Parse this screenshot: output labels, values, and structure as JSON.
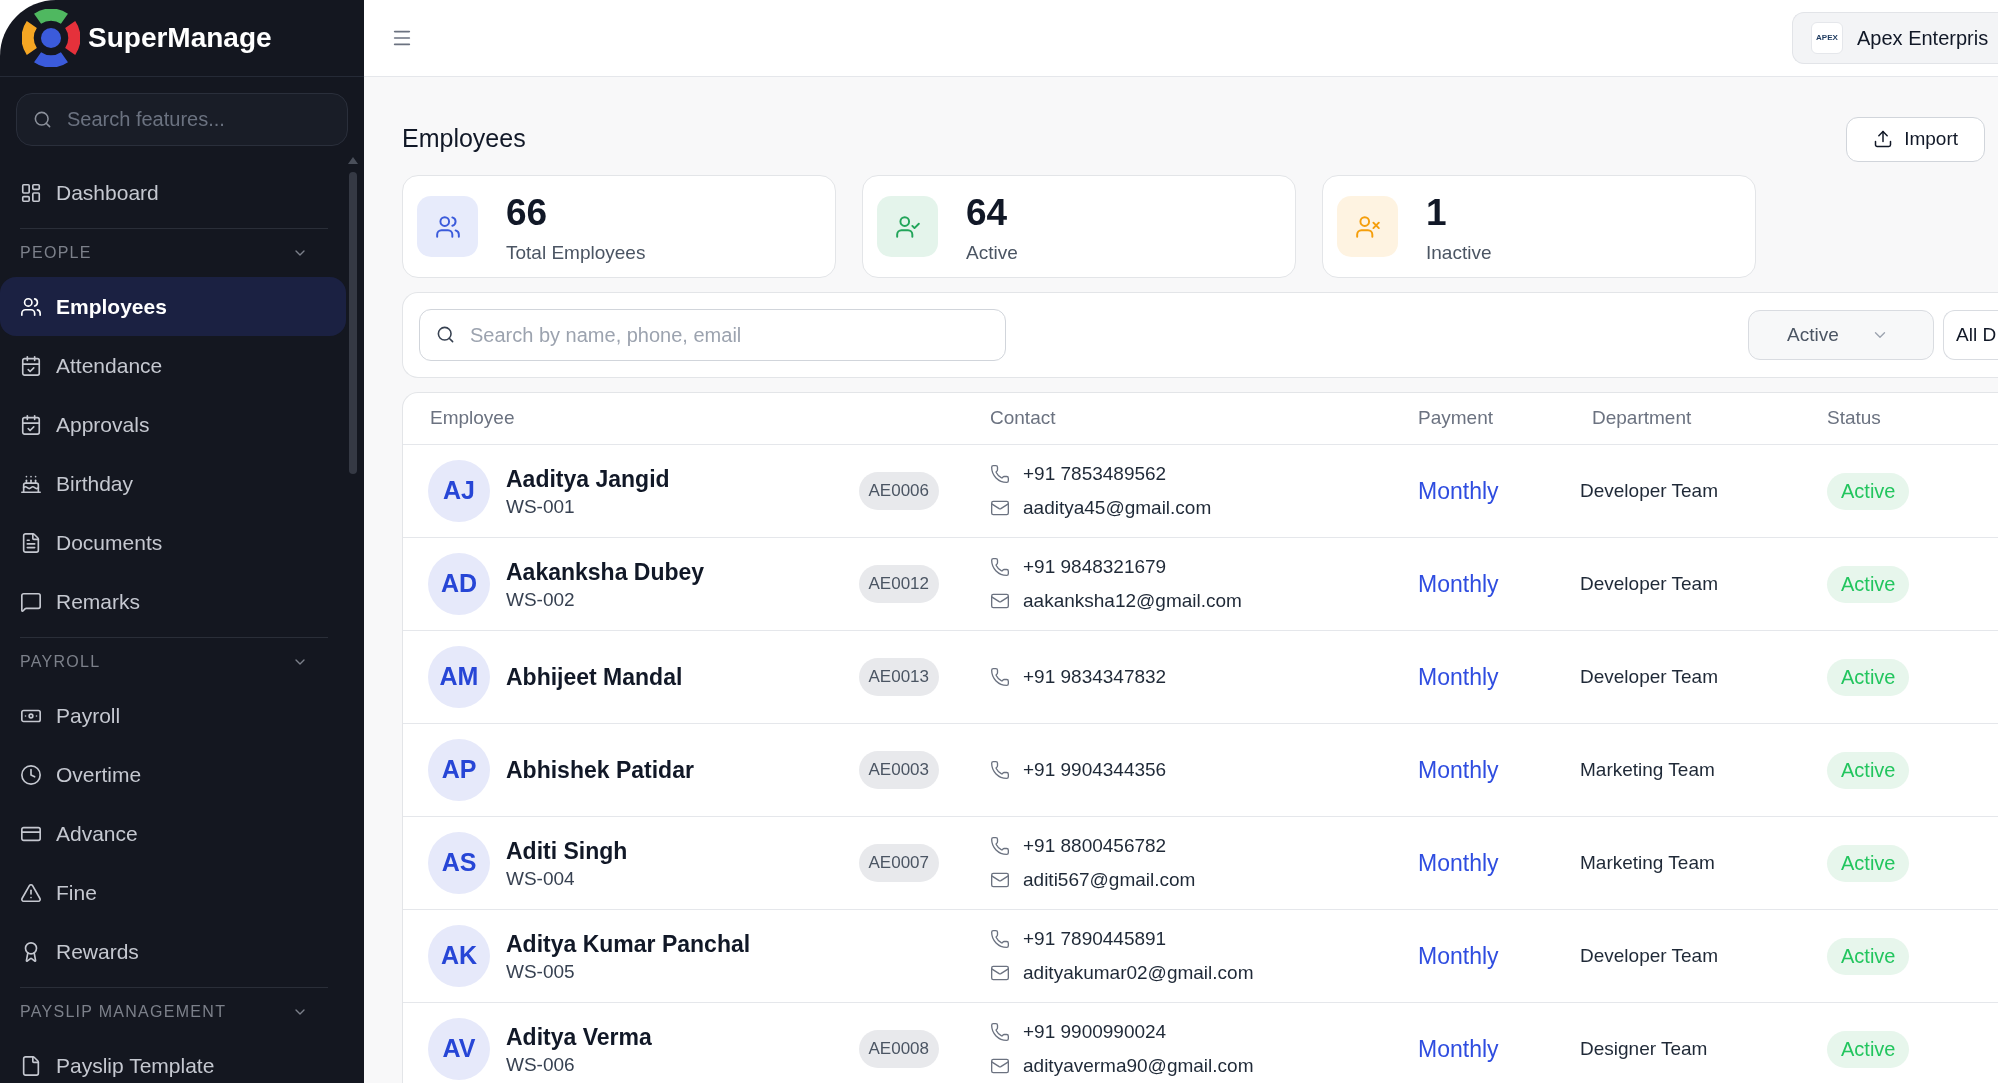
{
  "sidebar": {
    "brand": "SuperManage",
    "search": {
      "placeholder": "Search features..."
    },
    "top_items": [
      {
        "label": "Dashboard",
        "selected": false
      }
    ],
    "sections": [
      {
        "title": "PEOPLE",
        "expanded": true,
        "items": [
          {
            "label": "Employees",
            "selected": true
          },
          {
            "label": "Attendance",
            "selected": false
          },
          {
            "label": "Approvals",
            "selected": false
          },
          {
            "label": "Birthday",
            "selected": false
          },
          {
            "label": "Documents",
            "selected": false
          },
          {
            "label": "Remarks",
            "selected": false
          }
        ]
      },
      {
        "title": "PAYROLL",
        "expanded": true,
        "items": [
          {
            "label": "Payroll",
            "selected": false
          },
          {
            "label": "Overtime",
            "selected": false
          },
          {
            "label": "Advance",
            "selected": false
          },
          {
            "label": "Fine",
            "selected": false
          },
          {
            "label": "Rewards",
            "selected": false
          }
        ]
      },
      {
        "title": "PAYSLIP MANAGEMENT",
        "expanded": true,
        "items": [
          {
            "label": "Payslip Template",
            "selected": false
          }
        ]
      }
    ]
  },
  "top_bar": {
    "company": {
      "logo_text": "APEX",
      "name": "Apex Enterpris"
    }
  },
  "page": {
    "title": "Employees",
    "import_button": {
      "label": "Import"
    }
  },
  "stats": [
    {
      "value": "66",
      "label": "Total Employees",
      "color": "#3b5bdb"
    },
    {
      "value": "64",
      "label": "Active",
      "color": "#22a55a"
    },
    {
      "value": "1",
      "label": "Inactive",
      "color": "#f59e0b"
    }
  ],
  "filters": {
    "search": {
      "placeholder": "Search by name, phone, email"
    },
    "status": {
      "value": "Active"
    },
    "department": {
      "value": "All D"
    }
  },
  "table": {
    "columns": [
      "Employee",
      "Contact",
      "Payment",
      "Department",
      "Status"
    ],
    "rows": [
      {
        "initials": "AJ",
        "name": "Aaditya Jangid",
        "ws_id": "WS-001",
        "code": "AE0006",
        "phone": "+91 7853489562",
        "email": "aaditya45@gmail.com",
        "payment": "Monthly",
        "department": "Developer Team",
        "status": "Active"
      },
      {
        "initials": "AD",
        "name": "Aakanksha Dubey",
        "ws_id": "WS-002",
        "code": "AE0012",
        "phone": "+91 9848321679",
        "email": "aakanksha12@gmail.com",
        "payment": "Monthly",
        "department": "Developer Team",
        "status": "Active"
      },
      {
        "initials": "AM",
        "name": "Abhijeet Mandal",
        "code": "AE0013",
        "phone": "+91 9834347832",
        "payment": "Monthly",
        "department": "Developer Team",
        "status": "Active"
      },
      {
        "initials": "AP",
        "name": "Abhishek Patidar",
        "code": "AE0003",
        "phone": "+91 9904344356",
        "payment": "Monthly",
        "department": "Marketing Team",
        "status": "Active"
      },
      {
        "initials": "AS",
        "name": "Aditi Singh",
        "ws_id": "WS-004",
        "code": "AE0007",
        "phone": "+91 8800456782",
        "email": "aditi567@gmail.com",
        "payment": "Monthly",
        "department": "Marketing Team",
        "status": "Active"
      },
      {
        "initials": "AK",
        "name": "Aditya Kumar Panchal",
        "ws_id": "WS-005",
        "phone": "+91 7890445891",
        "email": "adityakumar02@gmail.com",
        "payment": "Monthly",
        "department": "Developer Team",
        "status": "Active"
      },
      {
        "initials": "AV",
        "name": "Aditya Verma",
        "ws_id": "WS-006",
        "code": "AE0008",
        "phone": "+91 9900990024",
        "email": "adityaverma90@gmail.com",
        "payment": "Monthly",
        "department": "Designer Team",
        "status": "Active"
      }
    ]
  }
}
